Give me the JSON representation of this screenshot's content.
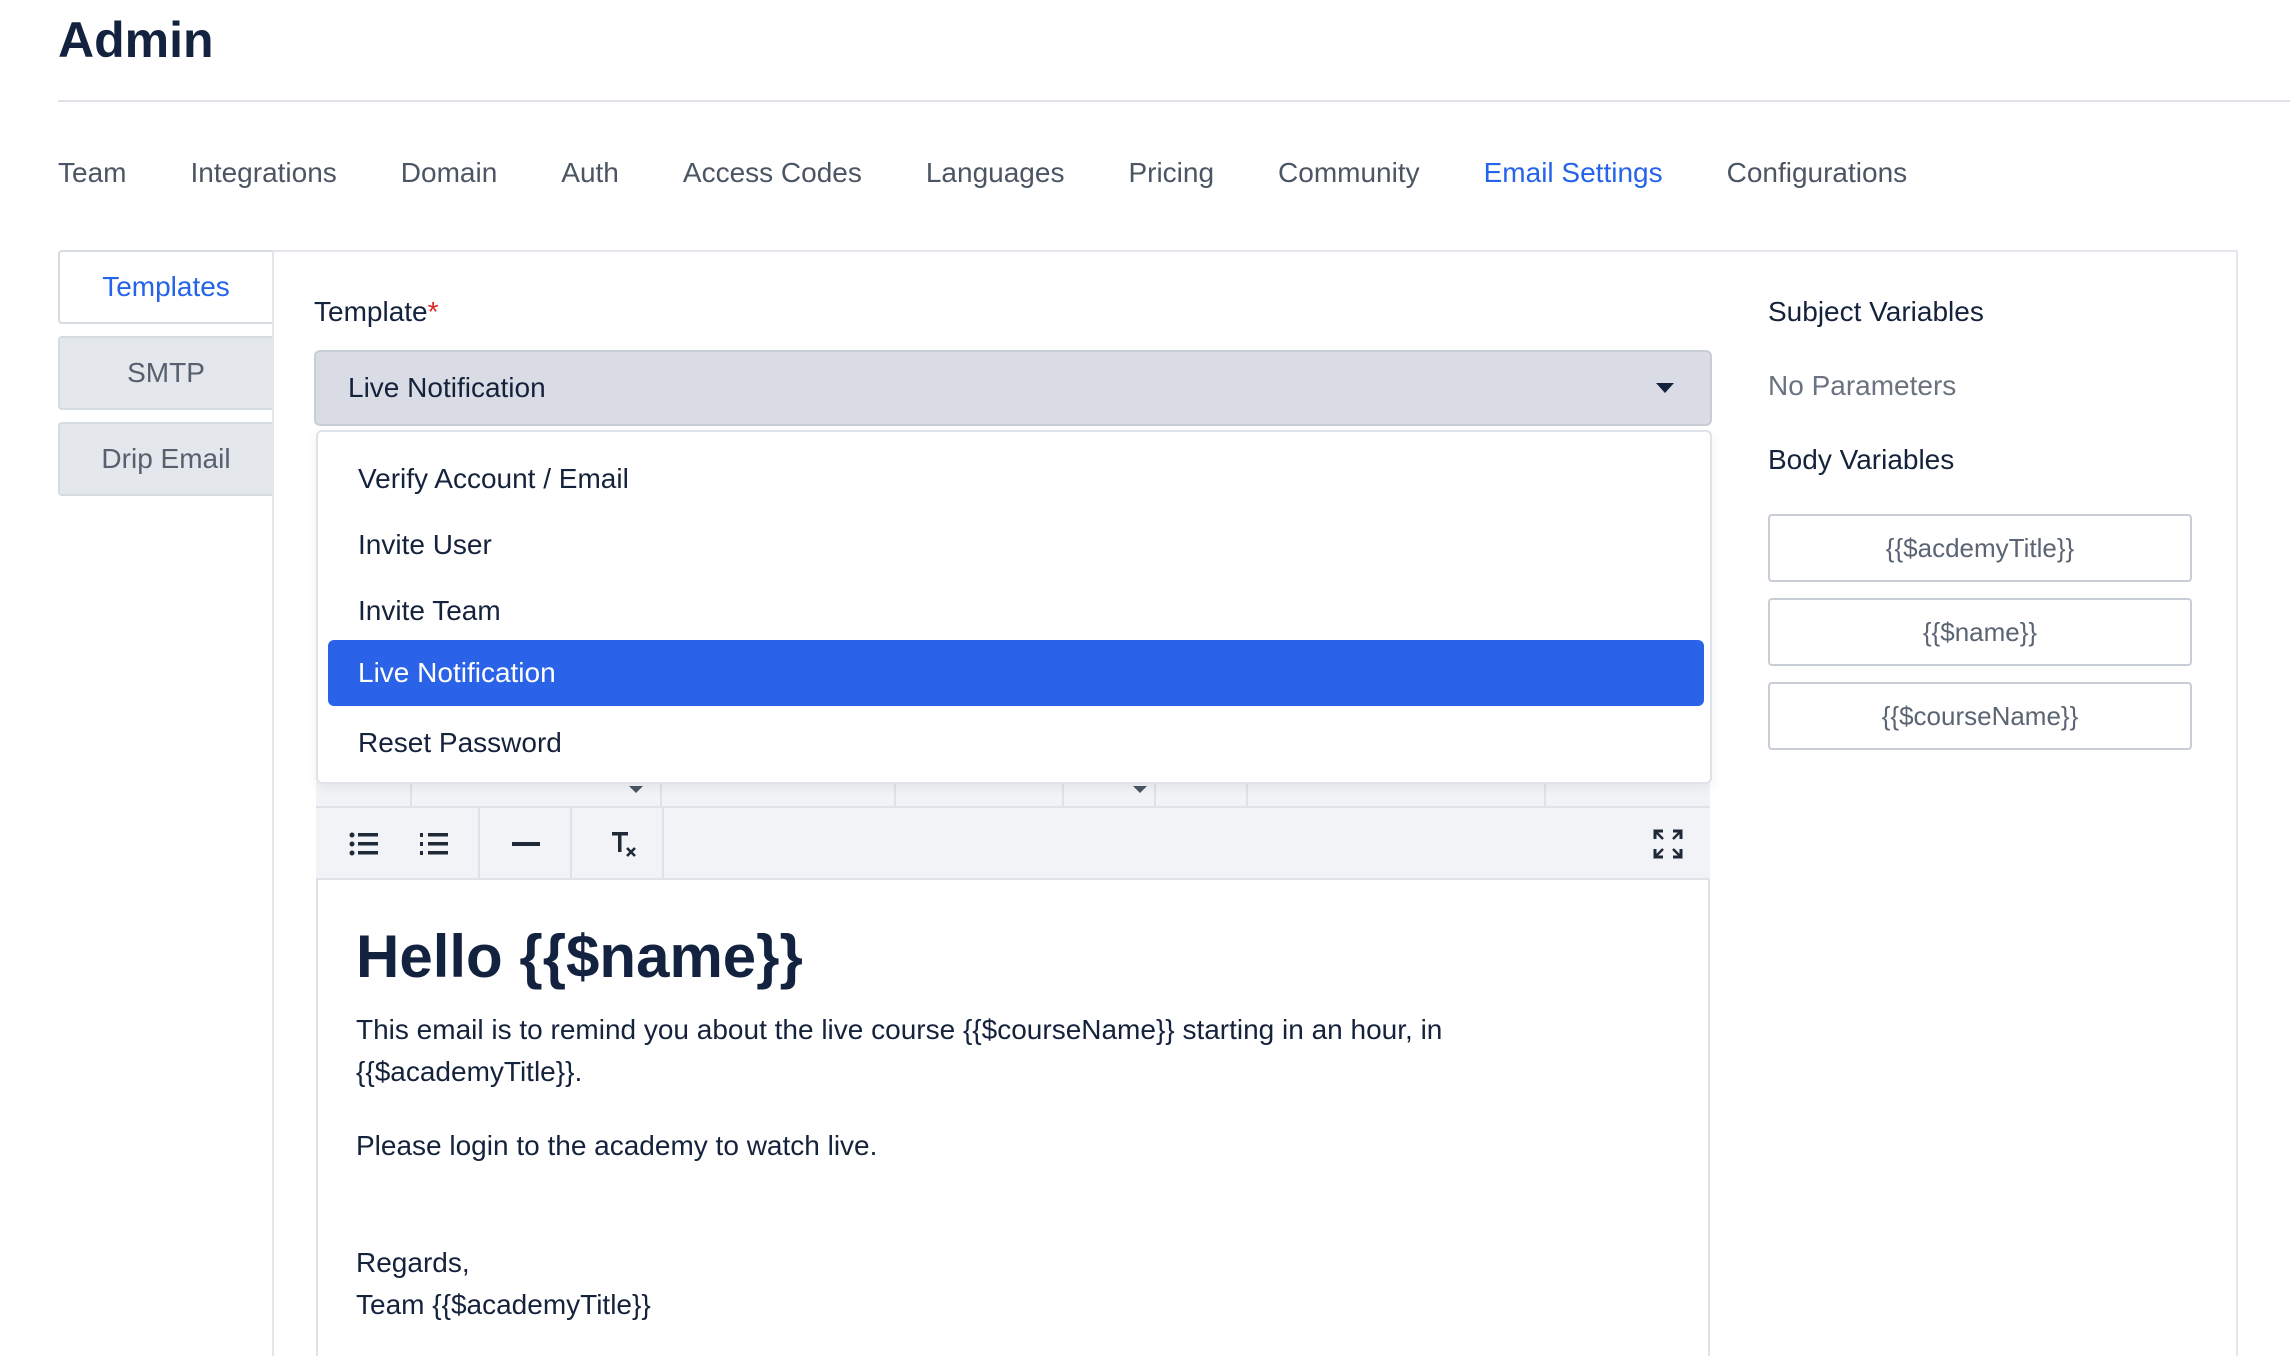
{
  "page": {
    "title": "Admin"
  },
  "tabs": [
    {
      "label": "Team"
    },
    {
      "label": "Integrations"
    },
    {
      "label": "Domain"
    },
    {
      "label": "Auth"
    },
    {
      "label": "Access Codes"
    },
    {
      "label": "Languages"
    },
    {
      "label": "Pricing"
    },
    {
      "label": "Community"
    },
    {
      "label": "Email Settings",
      "active": true
    },
    {
      "label": "Configurations"
    }
  ],
  "side_nav": [
    {
      "label": "Templates",
      "active": true
    },
    {
      "label": "SMTP"
    },
    {
      "label": "Drip Email"
    }
  ],
  "template_field": {
    "label": "Template",
    "required_mark": "*",
    "selected": "Live Notification",
    "options": [
      "Verify Account / Email",
      "Invite User",
      "Invite Team",
      "Live Notification",
      "Reset Password"
    ]
  },
  "editor": {
    "heading": "Hello {{$name}}",
    "paragraph1_line1": "This email is to remind you about the live course {{$courseName}} starting in an hour, in",
    "paragraph1_line2": "{{$academyTitle}}.",
    "paragraph2": "Please login to the academy to watch live.",
    "closing": "Regards,",
    "signature": "Team {{$academyTitle}}",
    "toolbar_icons": [
      "bulleted-list-icon",
      "numbered-list-icon",
      "horizontal-rule-icon",
      "clear-format-icon",
      "fullscreen-icon"
    ]
  },
  "variables": {
    "subject_title": "Subject Variables",
    "subject_empty": "No Parameters",
    "body_title": "Body Variables",
    "body": [
      "{{$acdemyTitle}}",
      "{{$name}}",
      "{{$courseName}}"
    ]
  },
  "colors": {
    "accent": "#2563eb",
    "selected_option": "#2b63e8",
    "required": "#dc2626"
  }
}
